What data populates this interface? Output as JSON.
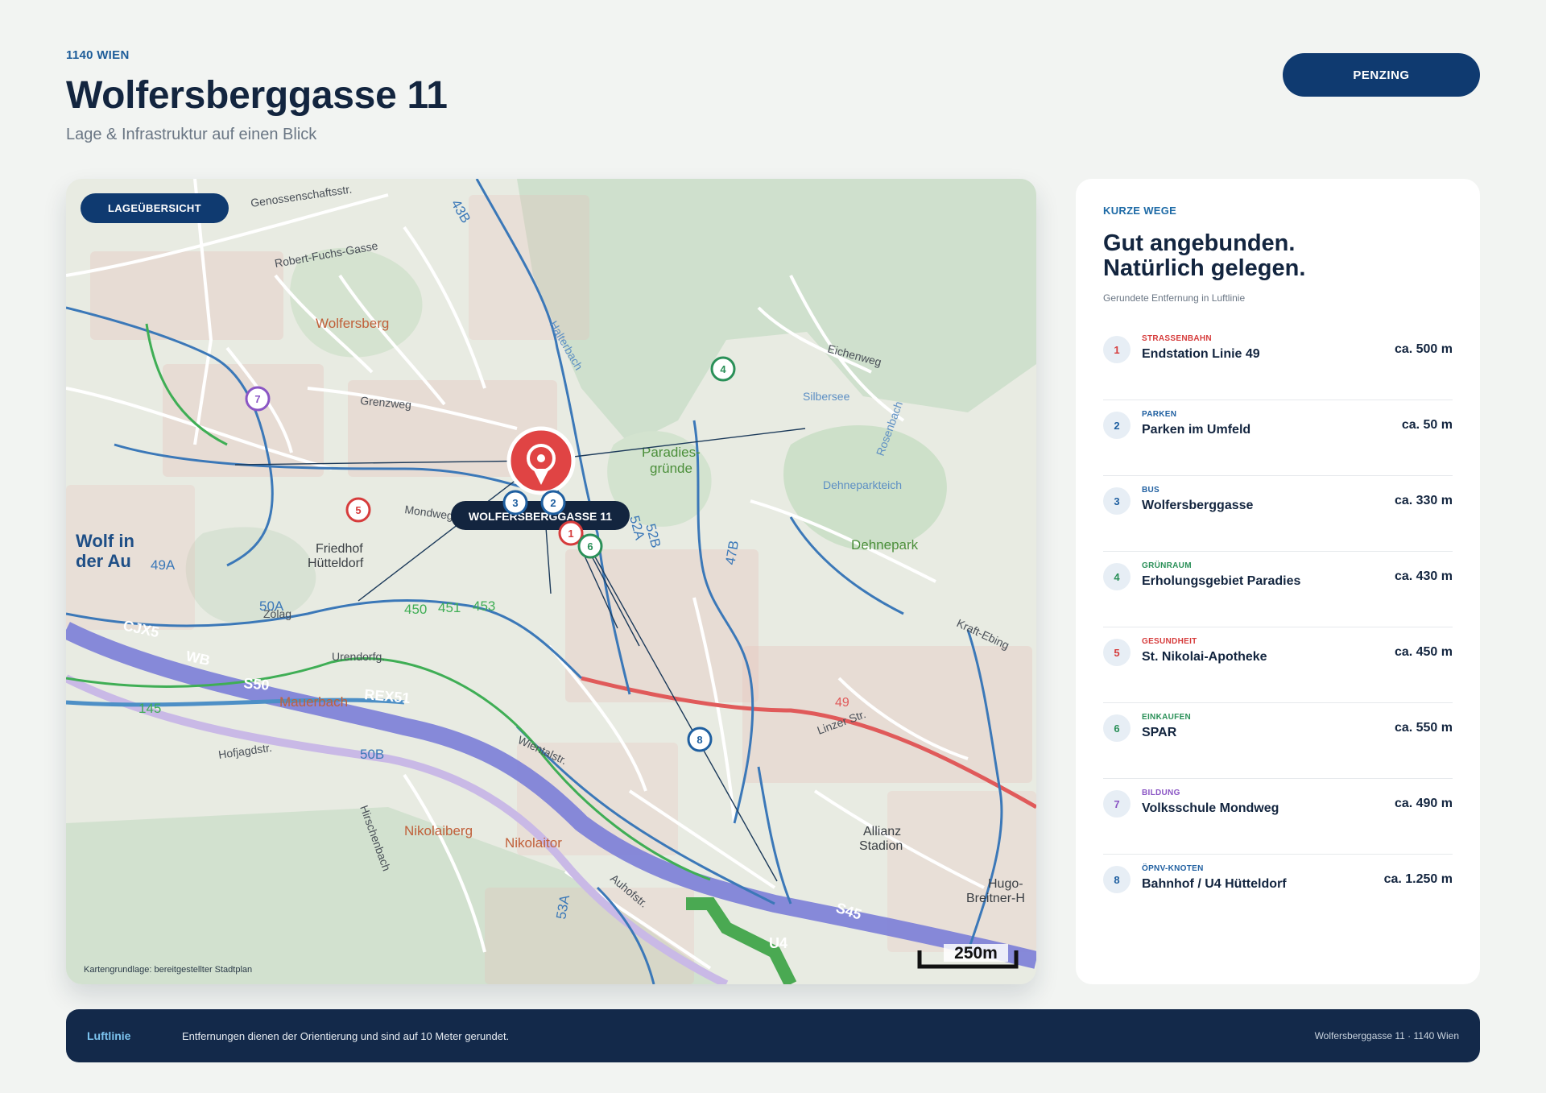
{
  "header": {
    "eyebrow": "1140 WIEN",
    "title": "Wolfersberggasse 11",
    "subtitle": "Lage & Infrastruktur auf einen Blick",
    "district_button": "PENZING"
  },
  "map": {
    "chip": "LAGEÜBERSICHT",
    "address_label": "WOLFERSBERGGASSE 11",
    "credit": "Kartengrundlage: bereitgestellter Stadtplan",
    "scale_label": "250m",
    "labels": {
      "wolfersberg": "Wolfersberg",
      "paradies_1": "Paradies-",
      "paradies_2": "gründe",
      "silbersee": "Silbersee",
      "dehnepark": "Dehnepark",
      "friedhof_1": "Friedhof",
      "friedhof_2": "Hütteldorf",
      "wolf_1": "Wolf in",
      "wolf_2": "der Au",
      "nikolaiberg": "Nikolaiberg",
      "nikolaitor": "Nikolaitor",
      "mauerbach": "Mauerbach",
      "allianz_1": "Allianz",
      "allianz_2": "Stadion",
      "hugo_1": "Hugo-",
      "hugo_2": "Breitner-H",
      "genossenschaftsstr": "Genossenschaftsstr.",
      "robert_fuchs": "Robert-Fuchs-Gasse",
      "grenzweg": "Grenzweg",
      "halterbach": "Halterbach",
      "rosenbach": "Rosenbach",
      "linzer_str": "Linzer Str.",
      "wientalstr": "Wientalstr.",
      "mondweg": "Mondweg",
      "hojagdstr": "Hofjagdstr.",
      "hirschenbach": "Hirschenbach",
      "dehneparkteich": "Dehneparkteich",
      "zoelag": "Zölag",
      "urendorfg": "Urendorfg.",
      "auhofstr": "Auhofstr.",
      "eichenweg": "Eichenweg",
      "kraffebing": "Kraft-Ebing"
    },
    "route_labels": {
      "r49a": "49A",
      "r50a": "50A",
      "r50b": "50B",
      "r52a": "52A",
      "r52b": "52B",
      "r43b": "43B",
      "r47b": "47B",
      "r49": "49",
      "r450": "450",
      "r451": "451",
      "r453": "453",
      "r145": "145",
      "s50": "S50",
      "s45": "S45",
      "rex51": "REX51",
      "cjx5": "CJX5",
      "wb": "WB",
      "u4": "U4",
      "r53a": "53A"
    },
    "markers": [
      {
        "num": "1",
        "color": "#d63c3c"
      },
      {
        "num": "2",
        "color": "#1f5fa0"
      },
      {
        "num": "3",
        "color": "#1f5fa0"
      },
      {
        "num": "4",
        "color": "#2a9058"
      },
      {
        "num": "5",
        "color": "#d63c3c"
      },
      {
        "num": "6",
        "color": "#2a9058"
      },
      {
        "num": "7",
        "color": "#8a55c4"
      },
      {
        "num": "8",
        "color": "#1f5fa0"
      }
    ]
  },
  "panel": {
    "eyebrow": "KURZE WEGE",
    "title_line1": "Gut angebunden.",
    "title_line2": "Natürlich gelegen.",
    "note": "Gerundete Entfernung in Luftlinie",
    "items": [
      {
        "num": "1",
        "category": "STRASSENBAHN",
        "name": "Endstation Linie 49",
        "distance": "ca. 500 m",
        "color": "#d63c3c"
      },
      {
        "num": "2",
        "category": "PARKEN",
        "name": "Parken im Umfeld",
        "distance": "ca. 50 m",
        "color": "#1f5fa0"
      },
      {
        "num": "3",
        "category": "BUS",
        "name": "Wolfersberggasse",
        "distance": "ca. 330 m",
        "color": "#1f5fa0"
      },
      {
        "num": "4",
        "category": "GRÜNRAUM",
        "name": "Erholungsgebiet Paradies",
        "distance": "ca. 430 m",
        "color": "#2a9058"
      },
      {
        "num": "5",
        "category": "GESUNDHEIT",
        "name": "St. Nikolai-Apotheke",
        "distance": "ca. 450 m",
        "color": "#d63c3c"
      },
      {
        "num": "6",
        "category": "EINKAUFEN",
        "name": "SPAR",
        "distance": "ca. 550 m",
        "color": "#2a9058"
      },
      {
        "num": "7",
        "category": "BILDUNG",
        "name": "Volksschule Mondweg",
        "distance": "ca. 490 m",
        "color": "#8a55c4"
      },
      {
        "num": "8",
        "category": "ÖPNV-KNOTEN",
        "name": "Bahnhof / U4 Hütteldorf",
        "distance": "ca. 1.250 m",
        "color": "#1f5fa0"
      }
    ]
  },
  "footer": {
    "tag": "Luftlinie",
    "text": "Entfernungen dienen der Orientierung und sind auf 10 Meter gerundet.",
    "address": "Wolfersberggasse 11 · 1140 Wien"
  }
}
